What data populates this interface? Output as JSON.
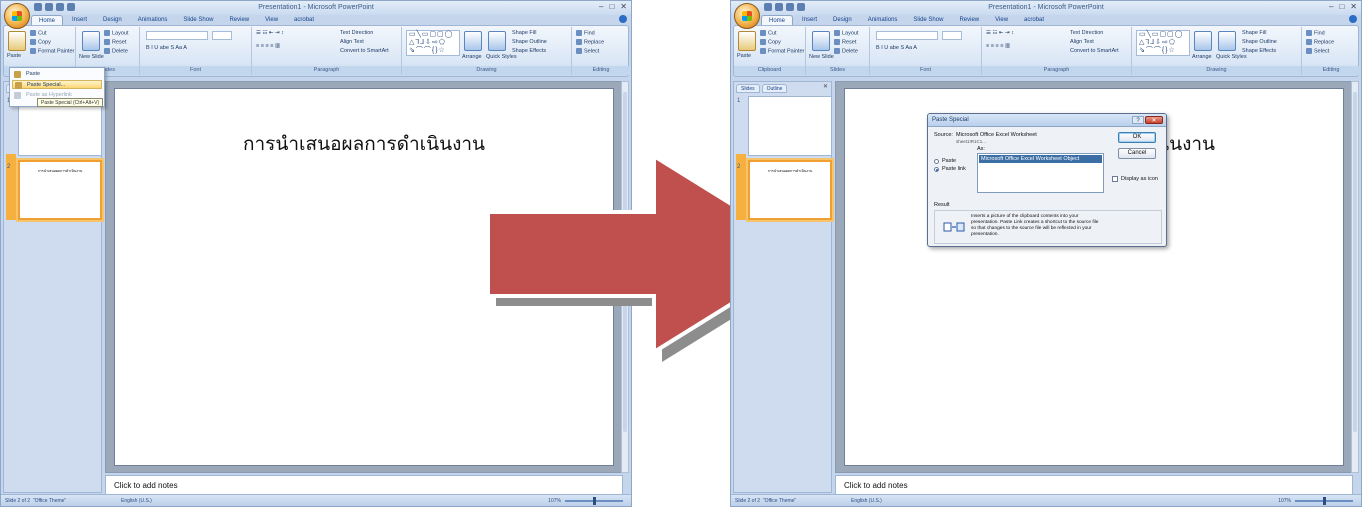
{
  "window_title": "Presentation1 - Microsoft PowerPoint",
  "tabs": [
    "Home",
    "Insert",
    "Design",
    "Animations",
    "Slide Show",
    "Review",
    "View",
    "acrobat"
  ],
  "ribbon": {
    "clipboard": {
      "paste": "Paste",
      "cut": "Cut",
      "copy": "Copy",
      "format_painter": "Format Painter",
      "label": "Clipboard"
    },
    "slides": {
      "new_slide": "New Slide",
      "layout": "Layout",
      "reset": "Reset",
      "delete": "Delete",
      "label": "Slides"
    },
    "font": {
      "label": "Font",
      "format_row": "B  I  U  abe  S  Aa  A"
    },
    "paragraph": {
      "label": "Paragraph",
      "text_direction": "Text Direction",
      "align_text": "Align Text",
      "convert": "Convert to SmartArt"
    },
    "drawing": {
      "label": "Drawing",
      "arrange": "Arrange",
      "quick_styles": "Quick Styles",
      "shape_fill": "Shape Fill",
      "shape_outline": "Shape Outline",
      "shape_effects": "Shape Effects",
      "shapes_glyphs": "▭╲▭▢▢◯ △⅂⅃⇩⇨⬠ ⇘⌒⌒{}☆"
    },
    "editing": {
      "label": "Editing",
      "find": "Find",
      "replace": "Replace",
      "select": "Select"
    }
  },
  "pane": {
    "tab_slides": "Slides",
    "tab_outline": "Outline",
    "thumb1": "1",
    "thumb2": "2",
    "thumb2_title": "การนำเสนอผลการดำเนินงาน"
  },
  "slide_title": "การนำเสนอผลการดำเนินงาน",
  "notes_placeholder": "Click to add notes",
  "status": {
    "slide": "Slide 2 of 2",
    "theme": "\"Office Theme\"",
    "language": "English (U.S.)",
    "zoom": "107%"
  },
  "paste_menu": {
    "items": [
      "Paste",
      "Paste Special...",
      "Paste as Hyperlink"
    ],
    "tooltip": "Paste Special (Ctrl+Alt+V)"
  },
  "dialog": {
    "title": "Paste Special",
    "source_label": "Source:",
    "source_value": "Microsoft Office Excel Worksheet",
    "source_sub": "sheet1!R1C1...",
    "as_label": "As:",
    "radio_paste": "Paste",
    "radio_paste_link": "Paste link",
    "list_option": "Microsoft Office Excel Worksheet Object",
    "ok": "OK",
    "cancel": "Cancel",
    "display_as_icon": "Display as icon",
    "result_label": "Result",
    "result_text": "Inserts a picture of the clipboard contents into your presentation. Paste Link creates a shortcut to the source file so that changes to the source file will be reflected in your presentation.",
    "result_icon": "paste-link-result-icon"
  },
  "colors": {
    "arrow_fill": "#c0504d",
    "arrow_shadow": "#7a7a7a",
    "selected_thumb": "#f0a030",
    "ribbon_text": "#15428b"
  }
}
